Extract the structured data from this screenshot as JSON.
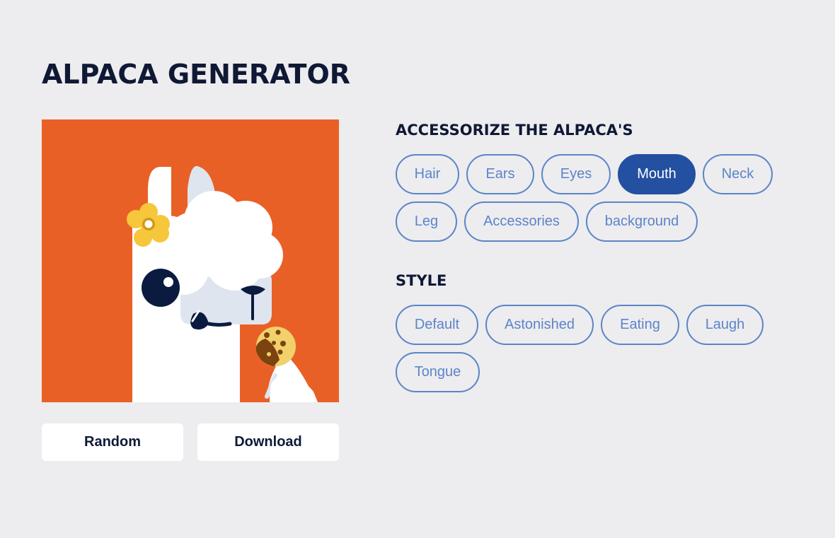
{
  "header": {
    "title": "ALPACA GENERATOR"
  },
  "actions": {
    "random_label": "Random",
    "download_label": "Download"
  },
  "accessorize": {
    "title": "ACCESSORIZE THE ALPACA'S",
    "items": [
      {
        "label": "Hair",
        "active": false
      },
      {
        "label": "Ears",
        "active": false
      },
      {
        "label": "Eyes",
        "active": false
      },
      {
        "label": "Mouth",
        "active": true
      },
      {
        "label": "Neck",
        "active": false
      },
      {
        "label": "Leg",
        "active": false
      },
      {
        "label": "Accessories",
        "active": false
      },
      {
        "label": "background",
        "active": false
      }
    ]
  },
  "style": {
    "title": "STYLE",
    "items": [
      {
        "label": "Default",
        "active": false
      },
      {
        "label": "Astonished",
        "active": false
      },
      {
        "label": "Eating",
        "active": false
      },
      {
        "label": "Laugh",
        "active": false
      },
      {
        "label": "Tongue",
        "active": false
      }
    ]
  },
  "colors": {
    "background": "#edecef",
    "title": "#0f1935",
    "pill_outline": "#5b85c8",
    "pill_active": "#2350a0",
    "canvas_bg": "#e96026"
  }
}
